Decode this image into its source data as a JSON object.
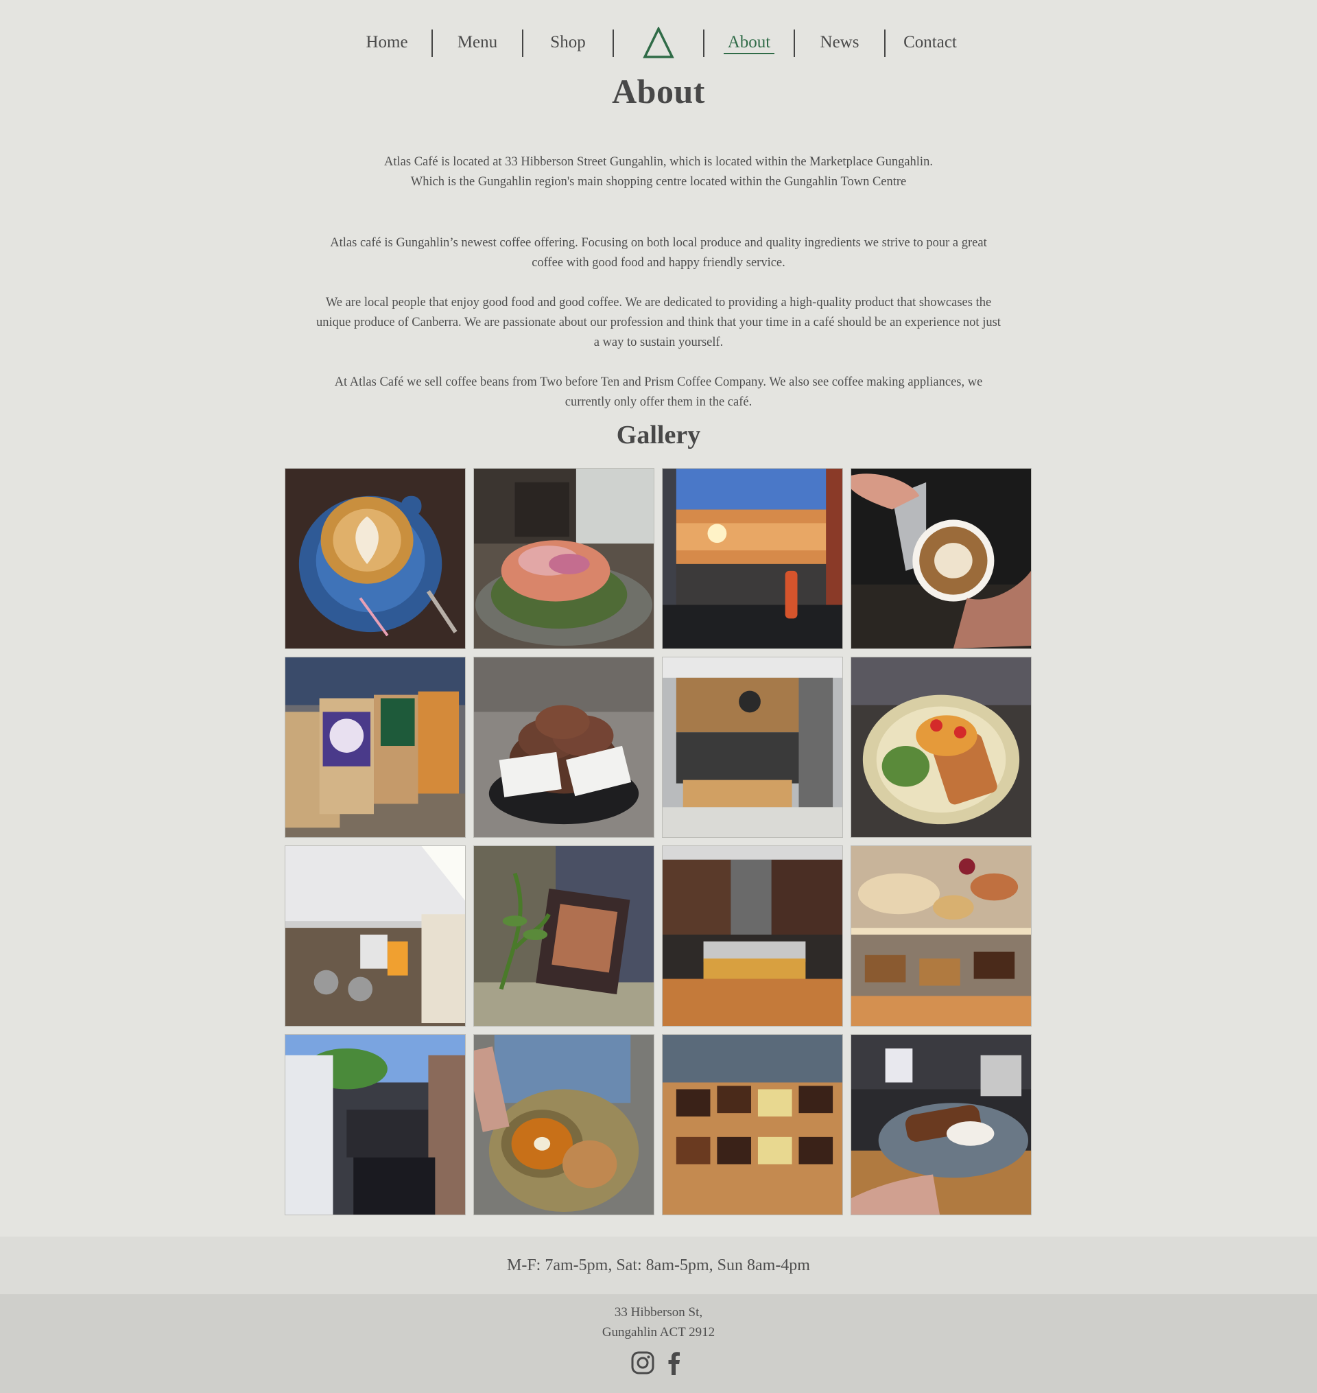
{
  "nav": {
    "items": [
      {
        "label": "Home"
      },
      {
        "label": "Menu"
      },
      {
        "label": "Shop"
      },
      {
        "label": "About",
        "active": true
      },
      {
        "label": "News"
      },
      {
        "label": "Contact"
      }
    ],
    "logo_icon": "atlas-triangle-logo",
    "accent_color": "#2f6b47"
  },
  "about": {
    "title": "About",
    "para1_line1": "Atlas Café is located at 33 Hibberson Street Gungahlin, which is located within the Marketplace Gungahlin.",
    "para1_line2": "Which is the Gungahlin region's main shopping centre located within the Gungahlin Town Centre",
    "para2": "Atlas café is Gungahlin’s newest coffee offering. Focusing on both local produce and quality ingredients we strive to pour a great coffee with good food and happy friendly service.",
    "para3": "We are local people that enjoy good food and good coffee. We are dedicated to providing a high-quality product that showcases the unique produce of Canberra. We are passionate about our profession and think that your time in a café should be an experience not just a way to sustain yourself.",
    "para4": "At Atlas Café we sell coffee beans from Two before Ten and Prism Coffee Company. We also see coffee making appliances, we currently only offer them in the café."
  },
  "gallery": {
    "title": "Gallery",
    "images": [
      "latte-art-cup",
      "salmon-bagel",
      "cafe-exterior-sunset",
      "milk-pour",
      "coffee-bean-bags",
      "cookie-sandwiches",
      "atlas-storefront",
      "toast-salad-plate",
      "coffee-bar-counter",
      "coffee-bag-plant",
      "barista-counter",
      "pastry-cabinet",
      "barista-at-machine",
      "soup-bowl",
      "brownie-slices",
      "cake-plate"
    ]
  },
  "hours": "M-F: 7am-5pm, Sat: 8am-5pm, Sun 8am-4pm",
  "footer": {
    "address_line1": "33 Hibberson St,",
    "address_line2": "Gungahlin ACT 2912",
    "social": [
      "instagram-icon",
      "facebook-icon"
    ]
  }
}
